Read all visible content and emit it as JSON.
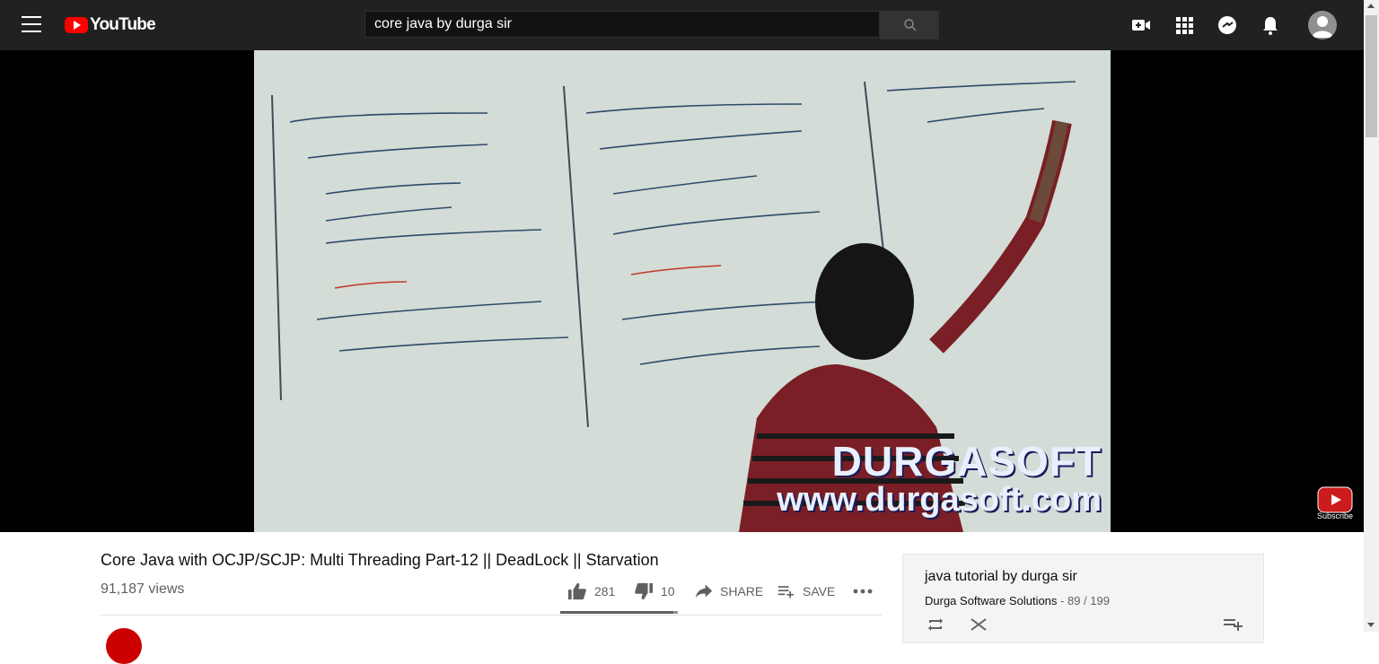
{
  "header": {
    "logo_text": "YouTube",
    "search_value": "core java by durga sir",
    "icons": [
      "menu-icon",
      "search-icon",
      "create-video-icon",
      "apps-grid-icon",
      "messages-icon",
      "notifications-icon",
      "account-avatar"
    ]
  },
  "player": {
    "watermark_line1": "DURGASOFT",
    "watermark_line2": "www.durgasoft.com",
    "subscribe_label": "Subscribe"
  },
  "video": {
    "title": "Core Java with OCJP/SCJP: Multi Threading Part-12 || DeadLock || Starvation",
    "views": "91,187 views",
    "likes": "281",
    "dislikes": "10",
    "share_label": "SHARE",
    "save_label": "SAVE",
    "like_ratio": 0.96
  },
  "playlist": {
    "title": "java tutorial by durga sir",
    "channel": "Durga Software Solutions",
    "position": " - 89 / 199"
  },
  "colors": {
    "topbar": "#212121",
    "brand_red": "#ff0000",
    "player_bg": "#000000",
    "panel_bg": "#f4f4f4"
  }
}
